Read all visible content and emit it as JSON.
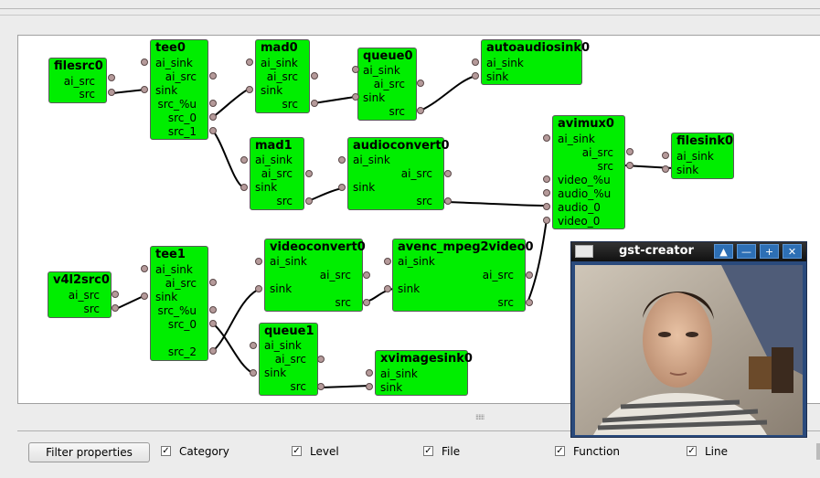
{
  "nodes": {
    "filesrc0": {
      "title": "filesrc0",
      "pads": [
        "ai_src",
        "src"
      ]
    },
    "tee0": {
      "title": "tee0",
      "pads": [
        "ai_sink",
        "ai_src",
        "sink",
        "src_%u",
        "src_0",
        "src_1"
      ]
    },
    "mad0": {
      "title": "mad0",
      "pads": [
        "ai_sink",
        "ai_src",
        "sink",
        "src"
      ]
    },
    "queue0": {
      "title": "queue0",
      "pads": [
        "ai_sink",
        "ai_src",
        "sink",
        "src"
      ]
    },
    "autoaudiosink0": {
      "title": "autoaudiosink0",
      "pads": [
        "ai_sink",
        "sink"
      ]
    },
    "mad1": {
      "title": "mad1",
      "pads": [
        "ai_sink",
        "ai_src",
        "sink",
        "src"
      ]
    },
    "audioconvert0": {
      "title": "audioconvert0",
      "pads": [
        "ai_sink",
        "ai_src",
        "sink",
        "src"
      ]
    },
    "avimux0": {
      "title": "avimux0",
      "pads": [
        "ai_sink",
        "ai_src",
        "src",
        "video_%u",
        "audio_%u",
        "audio_0",
        "video_0"
      ]
    },
    "filesink0": {
      "title": "filesink0",
      "pads": [
        "ai_sink",
        "sink"
      ]
    },
    "v4l2src0": {
      "title": "v4l2src0",
      "pads": [
        "ai_src",
        "src"
      ]
    },
    "tee1": {
      "title": "tee1",
      "pads": [
        "ai_sink",
        "ai_src",
        "sink",
        "src_%u",
        "src_0",
        "src_2"
      ]
    },
    "videoconvert0": {
      "title": "videoconvert0",
      "pads": [
        "ai_sink",
        "ai_src",
        "sink",
        "src"
      ]
    },
    "avenc": {
      "title": "avenc_mpeg2video0",
      "pads": [
        "ai_sink",
        "ai_src",
        "sink",
        "src"
      ]
    },
    "queue1": {
      "title": "queue1",
      "pads": [
        "ai_sink",
        "ai_src",
        "sink",
        "src"
      ]
    },
    "xvimagesink0": {
      "title": "xvimagesink0",
      "pads": [
        "ai_sink",
        "sink"
      ]
    }
  },
  "window": {
    "title": "gst-creator",
    "buttons": [
      "▲",
      "—",
      "+",
      "✕"
    ]
  },
  "toolbar": {
    "filter_button": "Filter properties",
    "checks": [
      {
        "label": "Category",
        "checked": true
      },
      {
        "label": "Level",
        "checked": true
      },
      {
        "label": "File",
        "checked": true
      },
      {
        "label": "Function",
        "checked": true
      },
      {
        "label": "Line",
        "checked": true
      }
    ]
  },
  "colors": {
    "node": "#00ee00",
    "link": "#000000",
    "pad": "#b59a9a"
  }
}
